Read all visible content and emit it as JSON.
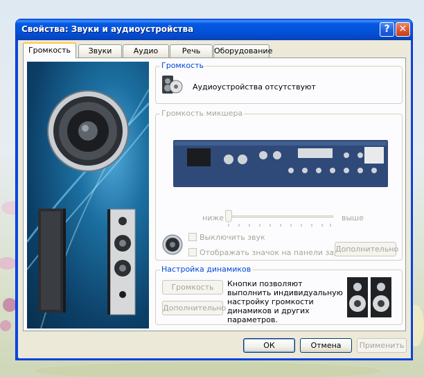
{
  "window": {
    "title": "Свойства: Звуки и аудиоустройства",
    "help_glyph": "?",
    "close_glyph": "✕"
  },
  "tabs": [
    {
      "label": "Громкость",
      "active": true
    },
    {
      "label": "Звуки",
      "active": false
    },
    {
      "label": "Аудио",
      "active": false
    },
    {
      "label": "Речь",
      "active": false
    },
    {
      "label": "Оборудование",
      "active": false
    }
  ],
  "volume_group": {
    "label": "Громкость",
    "status": "Аудиоустройства отсутствуют"
  },
  "mixer_group": {
    "label": "Громкость микшера",
    "slider_low": "ниже",
    "slider_high": "выше",
    "slider_value": 0,
    "mute_label": "Выключить звук",
    "taskbar_icon_label": "Отображать значок на панели задач",
    "advanced_button": "Дополнительно"
  },
  "speakers_group": {
    "label": "Настройка динамиков",
    "volume_button": "Громкость",
    "advanced_button": "Дополнительно",
    "description": "Кнопки позволяют выполнить индивидуальную настройку громкости динамиков и других параметров."
  },
  "footer": {
    "ok": "ОК",
    "cancel": "Отмена",
    "apply": "Применить"
  },
  "colors": {
    "title_blue": "#0351d8",
    "group_label": "#0046d5",
    "disabled_text": "#a6a69b",
    "active_tab_accent": "#ffc83c"
  }
}
